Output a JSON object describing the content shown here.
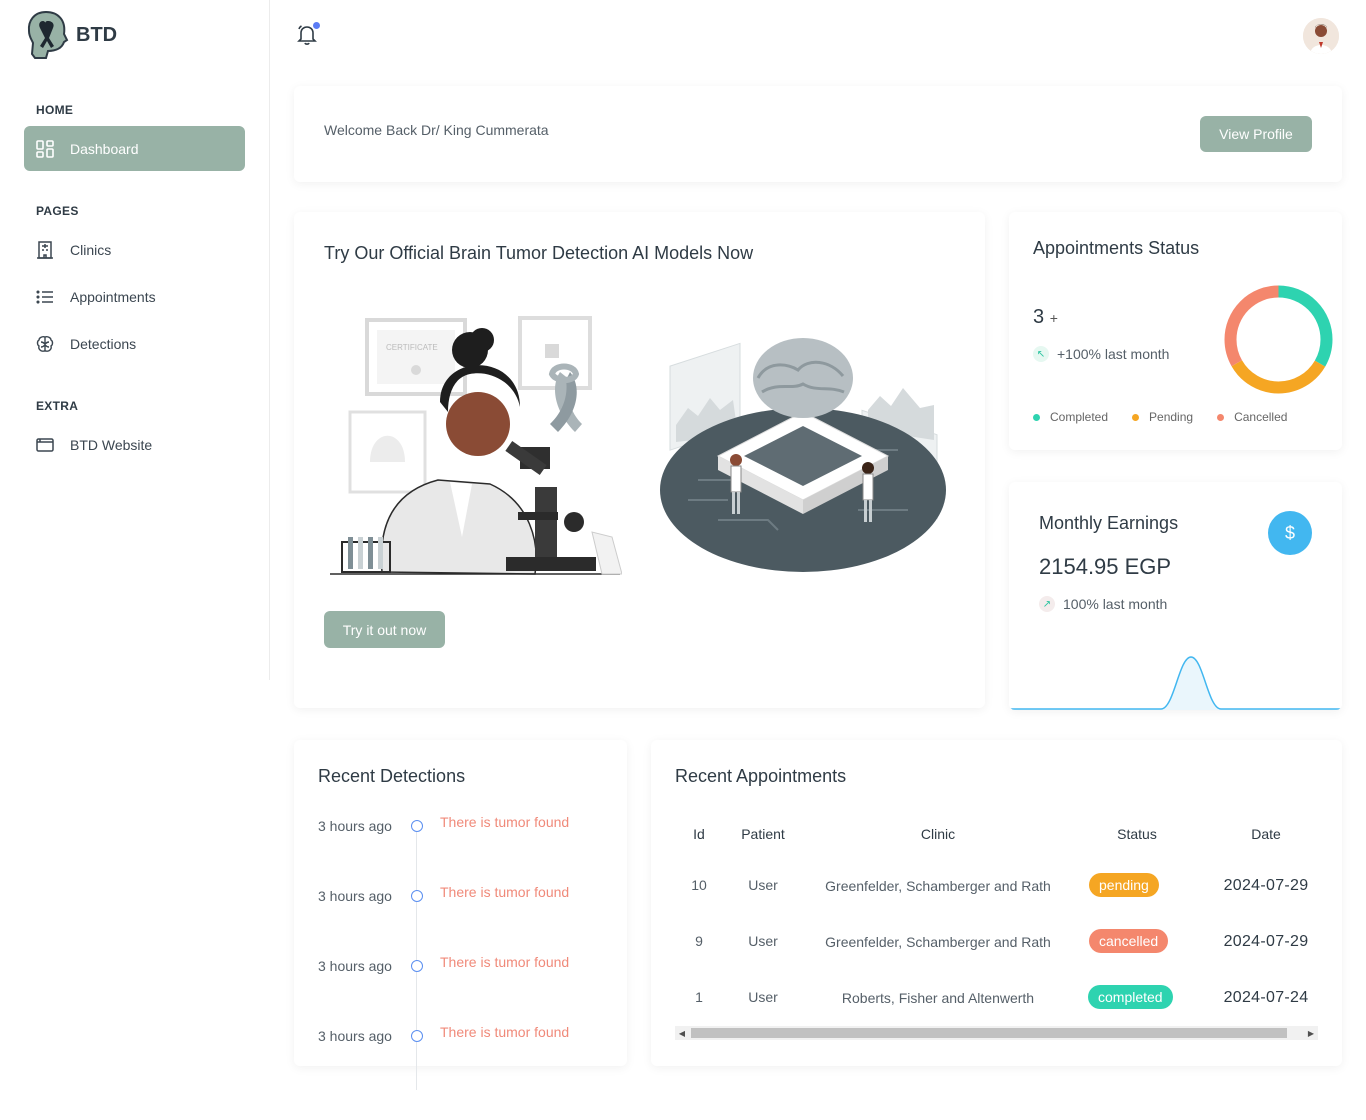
{
  "brand": {
    "name": "BTD"
  },
  "sidebar": {
    "sections": {
      "home": "HOME",
      "pages": "PAGES",
      "extra": "EXTRA"
    },
    "items": [
      {
        "label": "Dashboard",
        "icon": "dashboard-icon",
        "active": true
      },
      {
        "label": "Clinics",
        "icon": "building-icon"
      },
      {
        "label": "Appointments",
        "icon": "list-icon"
      },
      {
        "label": "Detections",
        "icon": "brain-icon"
      },
      {
        "label": "BTD Website",
        "icon": "browser-icon"
      }
    ]
  },
  "header": {
    "bell_icon": "bell-icon",
    "avatar": "doctor-avatar"
  },
  "welcome": {
    "text": "Welcome Back Dr/ King Cummerata",
    "button": "View Profile"
  },
  "ai_promo": {
    "title": "Try Our Official Brain Tumor Detection AI Models Now",
    "button": "Try it out now",
    "certificate_text": "CERTIFICATE"
  },
  "appointments_status": {
    "title": "Appointments Status",
    "count": "3",
    "count_suffix": "+",
    "trend": "+100% last month",
    "legend": [
      {
        "label": "Completed",
        "color": "#2ed3b0"
      },
      {
        "label": "Pending",
        "color": "#f5a623"
      },
      {
        "label": "Cancelled",
        "color": "#f4876d"
      }
    ]
  },
  "earnings": {
    "title": "Monthly Earnings",
    "value": "2154.95 EGP",
    "trend": "100% last month",
    "icon": "dollar-icon",
    "currency_symbol": "$"
  },
  "recent_detections": {
    "title": "Recent Detections",
    "items": [
      {
        "time": "3 hours ago",
        "message": "There is tumor found"
      },
      {
        "time": "3 hours ago",
        "message": "There is tumor found"
      },
      {
        "time": "3 hours ago",
        "message": "There is tumor found"
      },
      {
        "time": "3 hours ago",
        "message": "There is tumor found"
      }
    ]
  },
  "recent_appointments": {
    "title": "Recent Appointments",
    "columns": [
      "Id",
      "Patient",
      "Clinic",
      "Status",
      "Date"
    ],
    "rows": [
      {
        "id": "10",
        "patient": "User",
        "clinic": "Greenfelder, Schamberger and Rath",
        "status": "pending",
        "status_color": "#f5a623",
        "date": "2024-07-29"
      },
      {
        "id": "9",
        "patient": "User",
        "clinic": "Greenfelder, Schamberger and Rath",
        "status": "cancelled",
        "status_color": "#f4876d",
        "date": "2024-07-29"
      },
      {
        "id": "1",
        "patient": "User",
        "clinic": "Roberts, Fisher and Altenwerth",
        "status": "completed",
        "status_color": "#2ed3b0",
        "date": "2024-07-24"
      }
    ]
  },
  "colors": {
    "accent": "#98b2a6",
    "info": "#42b7f0"
  }
}
